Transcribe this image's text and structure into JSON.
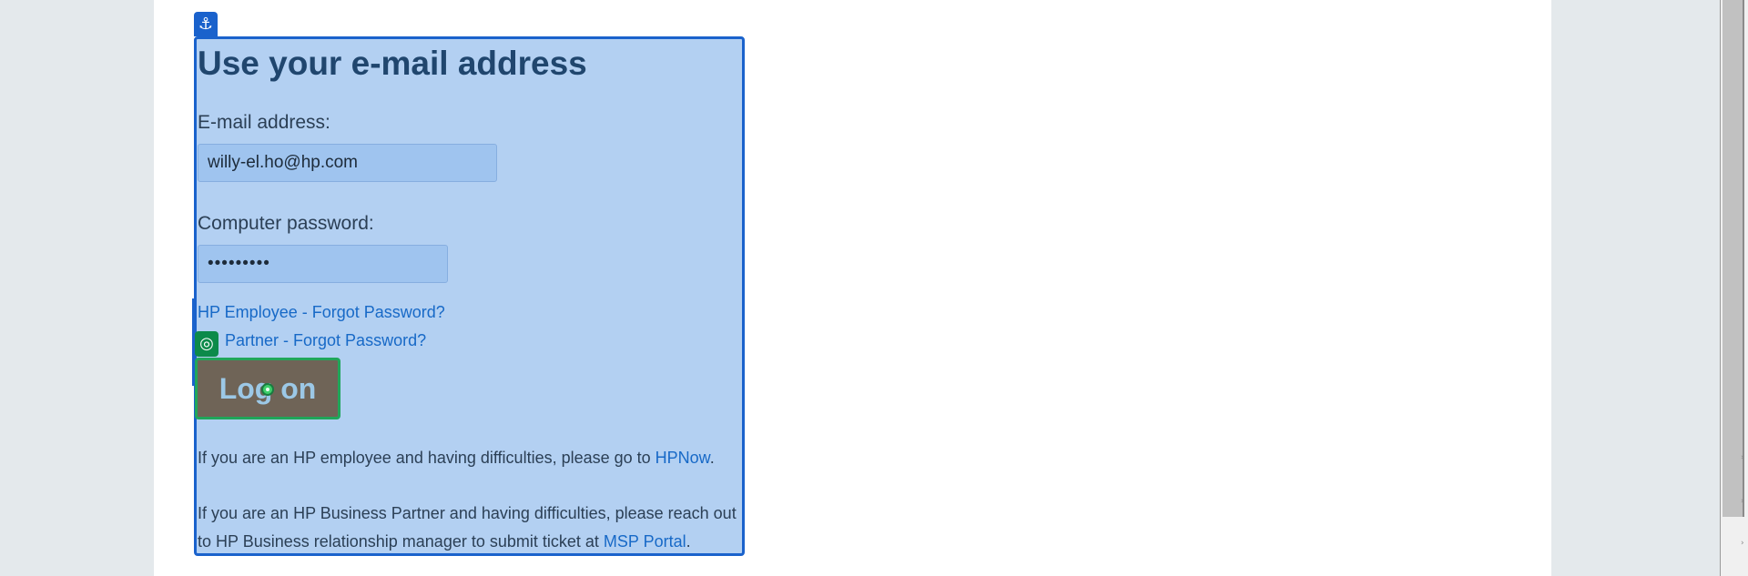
{
  "form": {
    "title": "Use your e-mail address",
    "email_label": "E-mail address:",
    "email_value": "willy-el.ho@hp.com",
    "password_label": "Computer password:",
    "password_value": "•••••••••",
    "employee_forgot_link": "HP Employee - Forgot Password?",
    "partner_forgot_link": "Partner - Forgot Password?",
    "logon_button": "Log on",
    "employee_note_prefix": "If you are an HP employee and having difficulties, please go to ",
    "employee_note_link": "HPNow",
    "employee_note_suffix": ".",
    "partner_note_prefix": "If you are an HP Business Partner and having difficulties, please reach out to HP Business relationship manager to submit ticket at ",
    "partner_note_link": "MSP Portal",
    "partner_note_suffix": "."
  },
  "overlay": {
    "anchor_icon": "⚓",
    "target_icon": "◎"
  },
  "colors": {
    "panel_bg": "#b3d0f2",
    "panel_border": "#1a62cc",
    "title": "#20466e",
    "link": "#1769c7",
    "button_bg": "#6f6457",
    "button_border": "#20a65a"
  }
}
